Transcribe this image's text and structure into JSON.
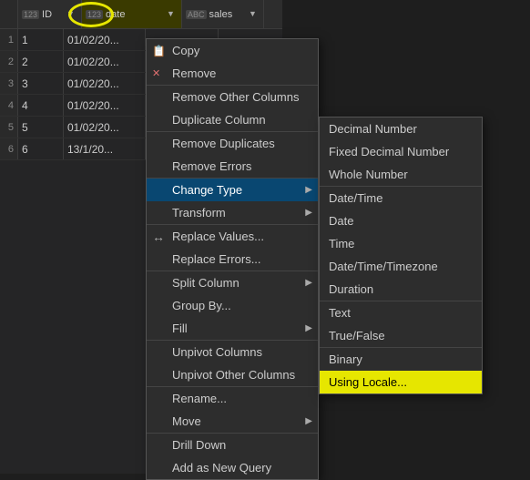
{
  "grid": {
    "columns": [
      {
        "label": "ID",
        "type": "123",
        "typeLabel": "123"
      },
      {
        "label": "date",
        "type": "123",
        "typeLabel": "123"
      },
      {
        "label": "sales",
        "type": "ABC",
        "typeLabel": "ABC"
      }
    ],
    "rows": [
      {
        "num": 1,
        "id": 1,
        "date": "01/02/20...",
        "sales": ""
      },
      {
        "num": 2,
        "id": 2,
        "date": "01/02/20...",
        "sales": ""
      },
      {
        "num": 3,
        "id": 3,
        "date": "01/02/20...",
        "sales": ""
      },
      {
        "num": 4,
        "id": 4,
        "date": "01/02/20...",
        "sales": ""
      },
      {
        "num": 5,
        "id": 5,
        "date": "01/02/20...",
        "sales": ""
      },
      {
        "num": 6,
        "id": 6,
        "date": "13/1/20...",
        "sales": ""
      }
    ]
  },
  "contextMenu": {
    "items": [
      {
        "label": "Copy",
        "icon": "📋",
        "hasSubmenu": false,
        "separatorAbove": false
      },
      {
        "label": "Remove",
        "icon": "✕",
        "hasSubmenu": false,
        "separatorAbove": false
      },
      {
        "label": "Remove Other Columns",
        "icon": "",
        "hasSubmenu": false,
        "separatorAbove": false
      },
      {
        "label": "Duplicate Column",
        "icon": "",
        "hasSubmenu": false,
        "separatorAbove": false
      },
      {
        "label": "Remove Duplicates",
        "icon": "",
        "hasSubmenu": false,
        "separatorAbove": false
      },
      {
        "label": "Remove Errors",
        "icon": "",
        "hasSubmenu": false,
        "separatorAbove": false
      },
      {
        "label": "Change Type",
        "icon": "",
        "hasSubmenu": true,
        "separatorAbove": false,
        "highlighted": true
      },
      {
        "label": "Transform",
        "icon": "",
        "hasSubmenu": true,
        "separatorAbove": false
      },
      {
        "label": "Replace Values...",
        "icon": "↔",
        "hasSubmenu": false,
        "separatorAbove": false
      },
      {
        "label": "Replace Errors...",
        "icon": "",
        "hasSubmenu": false,
        "separatorAbove": false
      },
      {
        "label": "Split Column",
        "icon": "",
        "hasSubmenu": true,
        "separatorAbove": false
      },
      {
        "label": "Group By...",
        "icon": "",
        "hasSubmenu": false,
        "separatorAbove": false
      },
      {
        "label": "Fill",
        "icon": "",
        "hasSubmenu": true,
        "separatorAbove": false
      },
      {
        "label": "Unpivot Columns",
        "icon": "",
        "hasSubmenu": false,
        "separatorAbove": false
      },
      {
        "label": "Unpivot Other Columns",
        "icon": "",
        "hasSubmenu": false,
        "separatorAbove": false
      },
      {
        "label": "Rename...",
        "icon": "",
        "hasSubmenu": false,
        "separatorAbove": false
      },
      {
        "label": "Move",
        "icon": "",
        "hasSubmenu": true,
        "separatorAbove": false
      },
      {
        "label": "Drill Down",
        "icon": "",
        "hasSubmenu": false,
        "separatorAbove": false
      },
      {
        "label": "Add as New Query",
        "icon": "",
        "hasSubmenu": false,
        "separatorAbove": false
      }
    ]
  },
  "submenu": {
    "items": [
      {
        "label": "Decimal Number",
        "separatorAbove": false
      },
      {
        "label": "Fixed Decimal Number",
        "separatorAbove": false
      },
      {
        "label": "Whole Number",
        "separatorAbove": false
      },
      {
        "label": "Date/Time",
        "separatorAbove": true
      },
      {
        "label": "Date",
        "separatorAbove": false
      },
      {
        "label": "Time",
        "separatorAbove": false
      },
      {
        "label": "Date/Time/Timezone",
        "separatorAbove": false
      },
      {
        "label": "Duration",
        "separatorAbove": false
      },
      {
        "label": "Text",
        "separatorAbove": true
      },
      {
        "label": "True/False",
        "separatorAbove": false
      },
      {
        "label": "Binary",
        "separatorAbove": true
      },
      {
        "label": "Using Locale...",
        "separatorAbove": false,
        "highlighted": true
      }
    ]
  }
}
